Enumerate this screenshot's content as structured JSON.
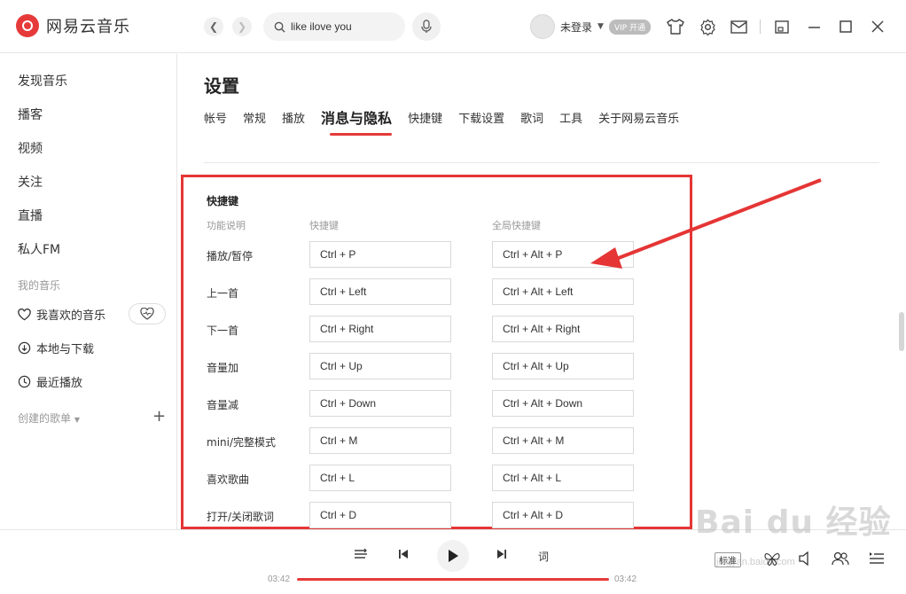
{
  "app": {
    "title": "网易云音乐",
    "accent": "#e63a3a"
  },
  "topbar": {
    "search_value": "like ilove you",
    "user_name": "未登录",
    "vip_badge": "开通",
    "icons": [
      "chevron-left-icon",
      "chevron-right-icon",
      "search-icon",
      "mic-icon",
      "tshirt-icon",
      "gear-icon",
      "mail-icon",
      "mini-mode-icon",
      "minimize-icon",
      "maximize-icon",
      "close-icon"
    ]
  },
  "sidebar": {
    "items": [
      {
        "label": "发现音乐"
      },
      {
        "label": "播客"
      },
      {
        "label": "视频"
      },
      {
        "label": "关注"
      },
      {
        "label": "直播"
      },
      {
        "label": "私人FM"
      }
    ],
    "my_music_title": "我的音乐",
    "my_music": [
      {
        "label": "我喜欢的音乐"
      },
      {
        "label": "本地与下载"
      },
      {
        "label": "最近播放"
      }
    ],
    "created_playlists": "创建的歌单"
  },
  "settings": {
    "title": "设置",
    "tabs": [
      {
        "label": "帐号"
      },
      {
        "label": "常规"
      },
      {
        "label": "播放"
      },
      {
        "label": "消息与隐私"
      },
      {
        "label": "快捷键"
      },
      {
        "label": "下载设置"
      },
      {
        "label": "歌词"
      },
      {
        "label": "工具"
      },
      {
        "label": "关于网易云音乐"
      }
    ],
    "active_tab": "消息与隐私",
    "shortcuts": {
      "title": "快捷键",
      "headers": [
        "功能说明",
        "快捷键",
        "全局快捷键"
      ],
      "rows": [
        {
          "label": "播放/暂停",
          "key": "Ctrl + P",
          "global": "Ctrl + Alt + P"
        },
        {
          "label": "上一首",
          "key": "Ctrl + Left",
          "global": "Ctrl + Alt + Left"
        },
        {
          "label": "下一首",
          "key": "Ctrl + Right",
          "global": "Ctrl + Alt + Right"
        },
        {
          "label": "音量加",
          "key": "Ctrl + Up",
          "global": "Ctrl + Alt + Up"
        },
        {
          "label": "音量减",
          "key": "Ctrl + Down",
          "global": "Ctrl + Alt + Down"
        },
        {
          "label": "mini/完整模式",
          "key": "Ctrl + M",
          "global": "Ctrl + Alt + M"
        },
        {
          "label": "喜欢歌曲",
          "key": "Ctrl + L",
          "global": "Ctrl + Alt + L"
        },
        {
          "label": "打开/关闭歌词",
          "key": "Ctrl + D",
          "global": "Ctrl + Alt + D"
        }
      ]
    }
  },
  "player": {
    "time_current": "03:42",
    "time_total": "03:42",
    "lyric_label": "词",
    "quality_label": "标准"
  },
  "watermark": {
    "text": "Bai du 经验",
    "sub": "jingyan.baidu.com"
  }
}
